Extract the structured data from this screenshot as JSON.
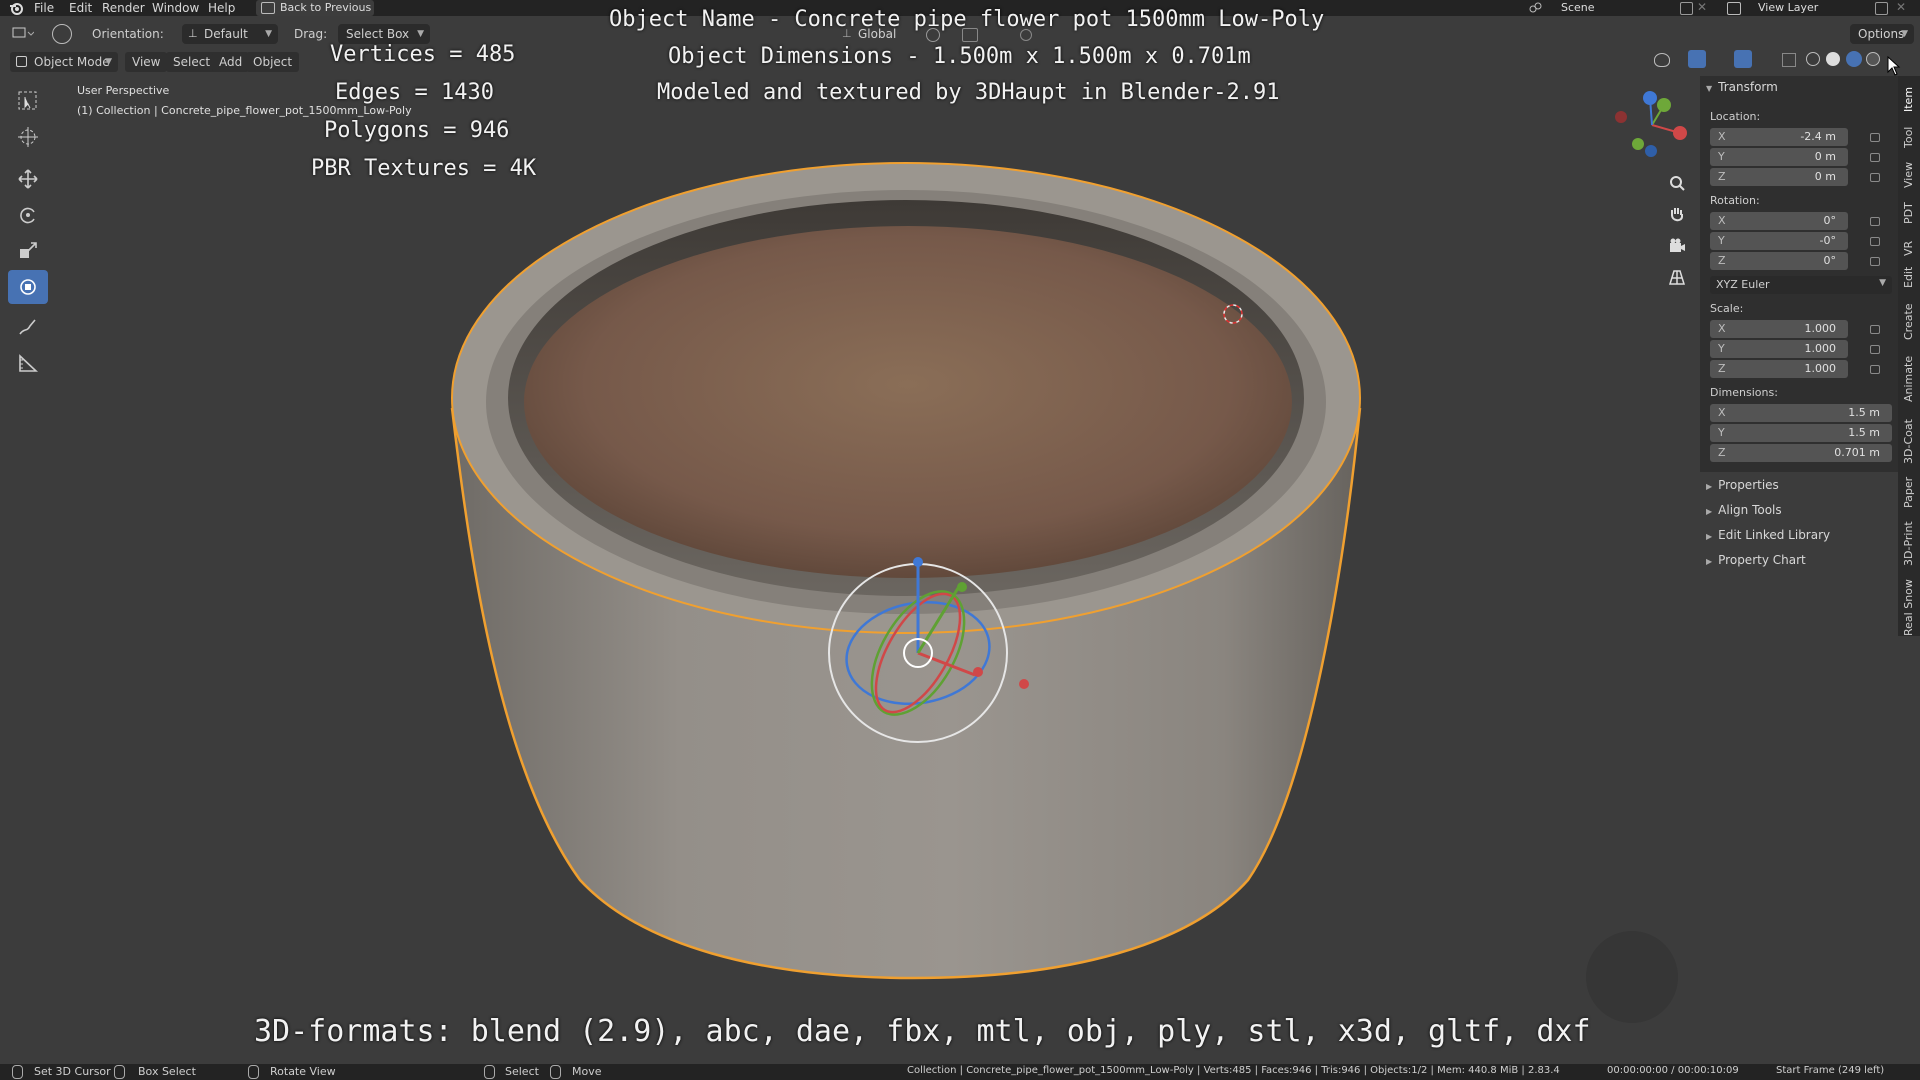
{
  "menubar": {
    "items": [
      "File",
      "Edit",
      "Render",
      "Window",
      "Help"
    ],
    "back_button": "Back to Previous",
    "scene": "Scene",
    "view_layer": "View Layer"
  },
  "header": {
    "orientation_label": "Orientation:",
    "orientation_value": "Default",
    "drag_label": "Drag:",
    "drag_value": "Select Box",
    "transform_space": "Global",
    "options": "Options",
    "mode": "Object Mode",
    "menus": [
      "View",
      "Select",
      "Add",
      "Object"
    ]
  },
  "viewport": {
    "perspective": "User Perspective",
    "collection_line": "(1) Collection | Concrete_pipe_flower_pot_1500mm_Low-Poly"
  },
  "overlay": {
    "vertices": "Vertices = 485",
    "edges": "Edges = 1430",
    "polygons": "Polygons = 946",
    "textures": "PBR Textures = 4K",
    "object_name": "Object Name - Concrete pipe flower pot 1500mm Low-Poly",
    "dimensions": "Object Dimensions -  1.500m x 1.500m x 0.701m",
    "credit": "Modeled and textured by 3DHaupt in Blender-2.91",
    "formats": "3D-formats: blend (2.9), abc, dae, fbx, mtl, obj, ply, stl, x3d, gltf, dxf"
  },
  "npanel": {
    "transform_title": "Transform",
    "location_label": "Location:",
    "location": [
      {
        "axis": "X",
        "value": "-2.4 m"
      },
      {
        "axis": "Y",
        "value": "0 m"
      },
      {
        "axis": "Z",
        "value": "0 m"
      }
    ],
    "rotation_label": "Rotation:",
    "rotation": [
      {
        "axis": "X",
        "value": "0°"
      },
      {
        "axis": "Y",
        "value": "-0°"
      },
      {
        "axis": "Z",
        "value": "0°"
      }
    ],
    "rotation_mode": "XYZ Euler",
    "scale_label": "Scale:",
    "scale": [
      {
        "axis": "X",
        "value": "1.000"
      },
      {
        "axis": "Y",
        "value": "1.000"
      },
      {
        "axis": "Z",
        "value": "1.000"
      }
    ],
    "dimensions_label": "Dimensions:",
    "dimensions": [
      {
        "axis": "X",
        "value": "1.5 m"
      },
      {
        "axis": "Y",
        "value": "1.5 m"
      },
      {
        "axis": "Z",
        "value": "0.701 m"
      }
    ],
    "sections": [
      "Properties",
      "Align Tools",
      "Edit Linked Library",
      "Property Chart"
    ]
  },
  "tabs": [
    "Item",
    "Tool",
    "View",
    "PDT",
    "VR",
    "Edit",
    "Create",
    "Animate",
    "3D-Coat",
    "Paper",
    "3D-Print",
    "Real Snow"
  ],
  "statusbar": {
    "set_cursor": "Set 3D Cursor",
    "box_select": "Box Select",
    "rotate_view": "Rotate View",
    "select": "Select",
    "move": "Move",
    "info": "Collection | Concrete_pipe_flower_pot_1500mm_Low-Poly | Verts:485 | Faces:946 | Tris:946 | Objects:1/2 | Mem: 440.8 MiB | 2.83.4",
    "timecode": "00:00:00:00 / 00:00:10:09",
    "start_frame": "Start Frame (249 left)"
  },
  "colors": {
    "selection_outline": "#f0a030",
    "active_tool": "#4772b3",
    "concrete": "#8f8a84",
    "soil": "#7a6048"
  }
}
